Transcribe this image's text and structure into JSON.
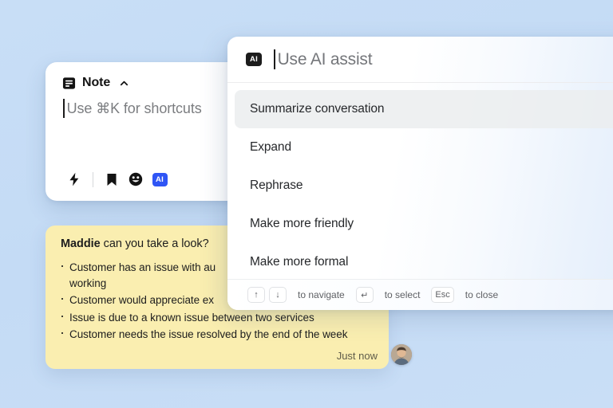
{
  "background": {
    "color": "#c6ddf6"
  },
  "note_card": {
    "icon": "note-document-icon",
    "title": "Note",
    "collapse_icon": "chevron-up-icon",
    "placeholder": "Use ⌘K for shortcuts",
    "toolbar": [
      {
        "name": "lightning-icon",
        "label": "Quick actions"
      },
      {
        "name": "bookmark-icon",
        "label": "Saved replies"
      },
      {
        "name": "emoji-icon",
        "label": "Emoji"
      },
      {
        "name": "ai-badge",
        "label": "AI",
        "color": "#2f55f5"
      }
    ]
  },
  "yellow_note": {
    "author": "Maddie",
    "lead": " can you take a look?",
    "bullets": [
      "Customer has an issue with au",
      "working",
      "Customer would appreciate ex",
      "Issue is due to a known issue between two services",
      "Customer needs the issue resolved by the end of the week"
    ],
    "timestamp": "Just now",
    "avatar": "user-avatar"
  },
  "ai_panel": {
    "badge": "AI",
    "badge_color": "#1c1c1c",
    "input_value": "",
    "input_placeholder": "Use AI assist",
    "options": [
      {
        "label": "Summarize conversation",
        "selected": true
      },
      {
        "label": "Expand",
        "selected": false
      },
      {
        "label": "Rephrase",
        "selected": false
      },
      {
        "label": "Make more friendly",
        "selected": false
      },
      {
        "label": "Make more formal",
        "selected": false
      }
    ],
    "footer": {
      "nav_up": "↑",
      "nav_down": "↓",
      "nav_label": "to navigate",
      "select_key": "↵",
      "select_label": "to select",
      "close_key": "Esc",
      "close_label": "to close"
    }
  }
}
